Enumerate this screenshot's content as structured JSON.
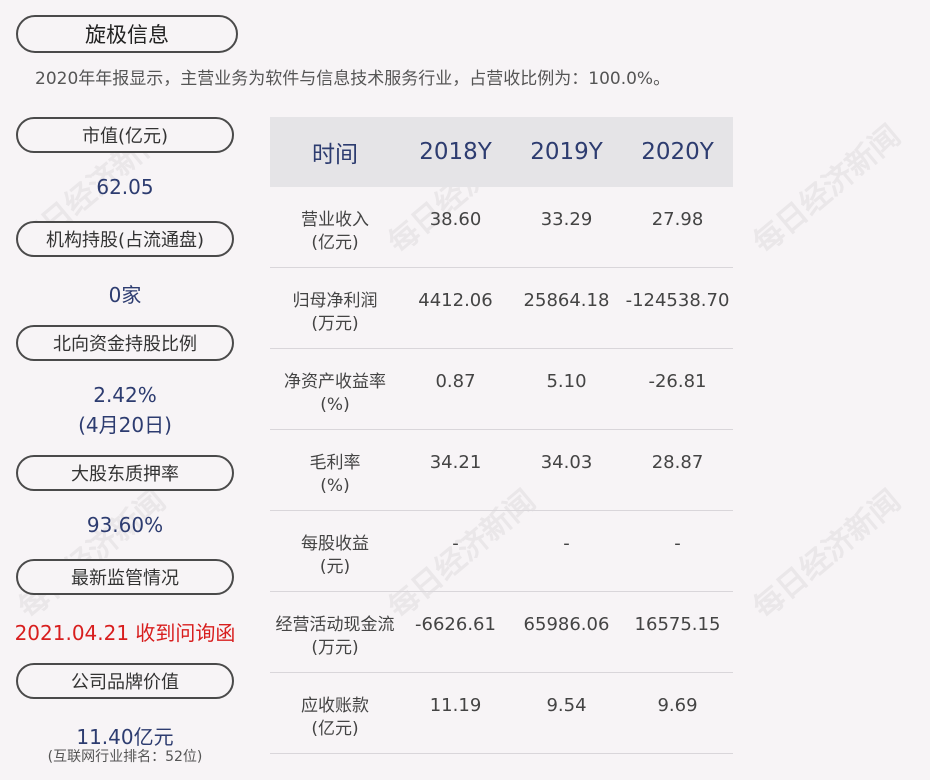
{
  "header": {
    "company": "旋极信息",
    "summary": "2020年年报显示，主营业务为软件与信息技术服务行业，占营收比例为：100.0%。"
  },
  "sidebar": [
    {
      "label": "市值(亿元)",
      "value": "62.05"
    },
    {
      "label": "机构持股(占流通盘)",
      "value": "0家"
    },
    {
      "label": "北向资金持股比例",
      "value": "2.42%",
      "value2": "(4月20日)"
    },
    {
      "label": "大股东质押率",
      "value": "93.60%"
    },
    {
      "label": "最新监管情况",
      "value": "2021.04.21 收到问询函"
    },
    {
      "label": "公司品牌价值",
      "value": "11.40亿元",
      "note": "(互联网行业排名：52位)"
    }
  ],
  "table": {
    "headers": [
      "时间",
      "2018Y",
      "2019Y",
      "2020Y"
    ],
    "rows": [
      {
        "label1": "营业收入",
        "label2": "(亿元)",
        "values": [
          "38.60",
          "33.29",
          "27.98"
        ]
      },
      {
        "label1": "归母净利润",
        "label2": "(万元)",
        "values": [
          "4412.06",
          "25864.18",
          "-124538.70"
        ]
      },
      {
        "label1": "净资产收益率",
        "label2": "(%)",
        "values": [
          "0.87",
          "5.10",
          "-26.81"
        ]
      },
      {
        "label1": "毛利率",
        "label2": "(%)",
        "values": [
          "34.21",
          "34.03",
          "28.87"
        ]
      },
      {
        "label1": "每股收益",
        "label2": "(元)",
        "values": [
          "-",
          "-",
          "-"
        ]
      },
      {
        "label1": "经营活动现金流",
        "label2": "(万元)",
        "values": [
          "-6626.61",
          "65986.06",
          "16575.15"
        ]
      },
      {
        "label1": "应收账款",
        "label2": "(亿元)",
        "values": [
          "11.19",
          "9.54",
          "9.69"
        ]
      }
    ]
  },
  "watermark": "每日经济新闻"
}
